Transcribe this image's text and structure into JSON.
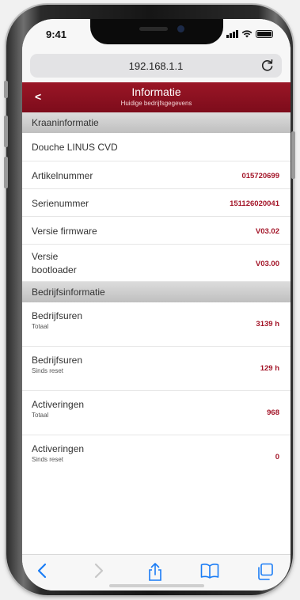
{
  "status": {
    "time": "9:41"
  },
  "browser": {
    "url": "192.168.1.1"
  },
  "header": {
    "back_label": "<",
    "title": "Informatie",
    "subtitle": "Huidige bedrijfsgegevens"
  },
  "sections": {
    "kraan": {
      "title": "Kraaninformatie",
      "product": "Douche LINUS CVD",
      "artikel": {
        "label": "Artikelnummer",
        "value": "015720699"
      },
      "serie": {
        "label": "Serienummer",
        "value": "151126020041"
      },
      "firmware": {
        "label": "Versie firmware",
        "value": "V03.02"
      },
      "bootloader": {
        "label": "Versie bootloader",
        "value": "V03.00"
      }
    },
    "bedrijf": {
      "title": "Bedrijfsinformatie",
      "rows": [
        {
          "label": "Bedrijfsuren",
          "sublabel": "Totaal",
          "value": "3139 h"
        },
        {
          "label": "Bedrijfsuren",
          "sublabel": "Sinds reset",
          "value": "129 h"
        },
        {
          "label": "Activeringen",
          "sublabel": "Totaal",
          "value": "968"
        },
        {
          "label": "Activeringen",
          "sublabel": "Sinds reset",
          "value": "0"
        }
      ]
    }
  },
  "toolbar": {
    "icons": [
      "back-icon",
      "forward-icon",
      "share-icon",
      "bookmarks-icon",
      "tabs-icon"
    ]
  },
  "colors": {
    "accent": "#8b1020",
    "value": "#a31528",
    "ios_blue": "#1a7cf5"
  }
}
